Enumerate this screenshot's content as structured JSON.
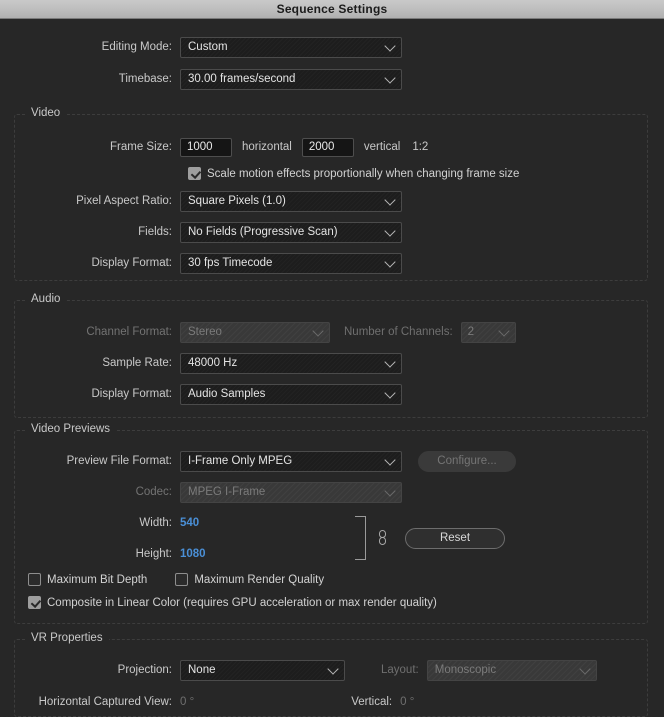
{
  "window": {
    "title": "Sequence Settings"
  },
  "top": {
    "editing_mode": {
      "label": "Editing Mode:",
      "value": "Custom"
    },
    "timebase": {
      "label": "Timebase:",
      "value": "30.00  frames/second"
    }
  },
  "video": {
    "section_title": "Video",
    "frame_size": {
      "label": "Frame Size:",
      "horizontal_value": "1000",
      "horizontal_label": "horizontal",
      "vertical_value": "2000",
      "vertical_label": "vertical",
      "ratio": "1:2"
    },
    "scale_motion": {
      "label": "Scale motion effects proportionally when changing frame size",
      "checked": true
    },
    "pixel_aspect_ratio": {
      "label": "Pixel Aspect Ratio:",
      "value": "Square Pixels (1.0)"
    },
    "fields": {
      "label": "Fields:",
      "value": "No Fields (Progressive Scan)"
    },
    "display_format": {
      "label": "Display Format:",
      "value": "30 fps Timecode"
    }
  },
  "audio": {
    "section_title": "Audio",
    "channel_format": {
      "label": "Channel Format:",
      "value": "Stereo",
      "disabled": true
    },
    "number_of_channels": {
      "label": "Number of Channels:",
      "value": "2",
      "disabled": true
    },
    "sample_rate": {
      "label": "Sample Rate:",
      "value": "48000 Hz"
    },
    "display_format": {
      "label": "Display Format:",
      "value": "Audio Samples"
    }
  },
  "video_previews": {
    "section_title": "Video Previews",
    "preview_file_format": {
      "label": "Preview File Format:",
      "value": "I-Frame Only MPEG"
    },
    "configure_button": {
      "label": "Configure...",
      "disabled": true
    },
    "codec": {
      "label": "Codec:",
      "value": "MPEG I-Frame",
      "disabled": true
    },
    "width": {
      "label": "Width:",
      "value": "540"
    },
    "height": {
      "label": "Height:",
      "value": "1080"
    },
    "reset_button": {
      "label": "Reset"
    },
    "link_icon": "chain-link-icon",
    "maximum_bit_depth": {
      "label": "Maximum Bit Depth",
      "checked": false
    },
    "maximum_render_quality": {
      "label": "Maximum Render Quality",
      "checked": false
    },
    "composite_linear_color": {
      "label": "Composite in Linear Color (requires GPU acceleration or max render quality)",
      "checked": true
    }
  },
  "vr_properties": {
    "section_title": "VR Properties",
    "projection": {
      "label": "Projection:",
      "value": "None"
    },
    "layout": {
      "label": "Layout:",
      "value": "Monoscopic",
      "disabled": true
    },
    "horizontal_captured_view": {
      "label": "Horizontal Captured View:",
      "value": "0 °",
      "disabled": true
    },
    "vertical": {
      "label": "Vertical:",
      "value": "0 °",
      "disabled": true
    }
  },
  "colors": {
    "background": "#272727",
    "titlebar": "#bdbdbd",
    "accent_blue": "#4a8fd6",
    "field_bg": "#1d1d1d",
    "disabled_text": "#757575"
  }
}
